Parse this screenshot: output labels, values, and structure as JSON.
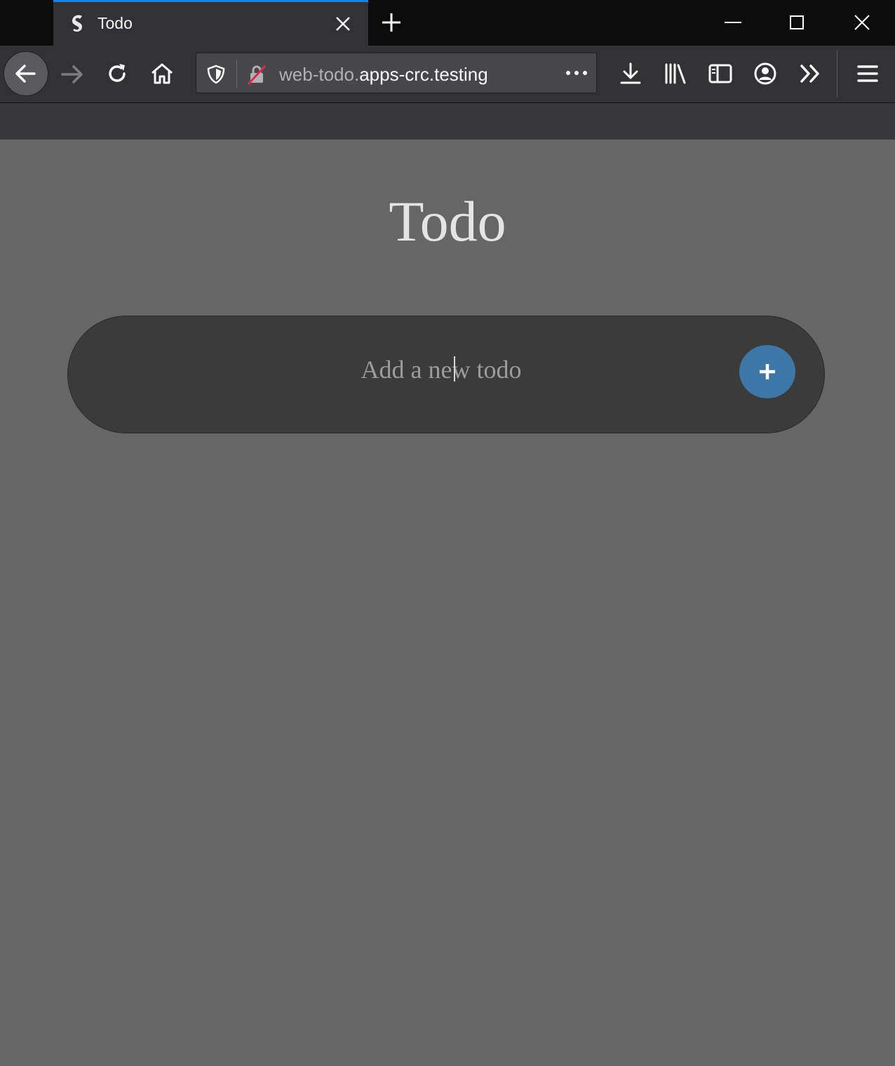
{
  "browser": {
    "tab": {
      "title": "Todo"
    },
    "url": {
      "prefix": "web-todo.",
      "host": "apps-crc.testing"
    },
    "accent_color": "#0a84ff"
  },
  "page": {
    "title": "Todo",
    "input": {
      "placeholder": "Add a new todo",
      "value": ""
    },
    "add_button": {
      "label": "+",
      "color": "#3d77a8"
    }
  }
}
